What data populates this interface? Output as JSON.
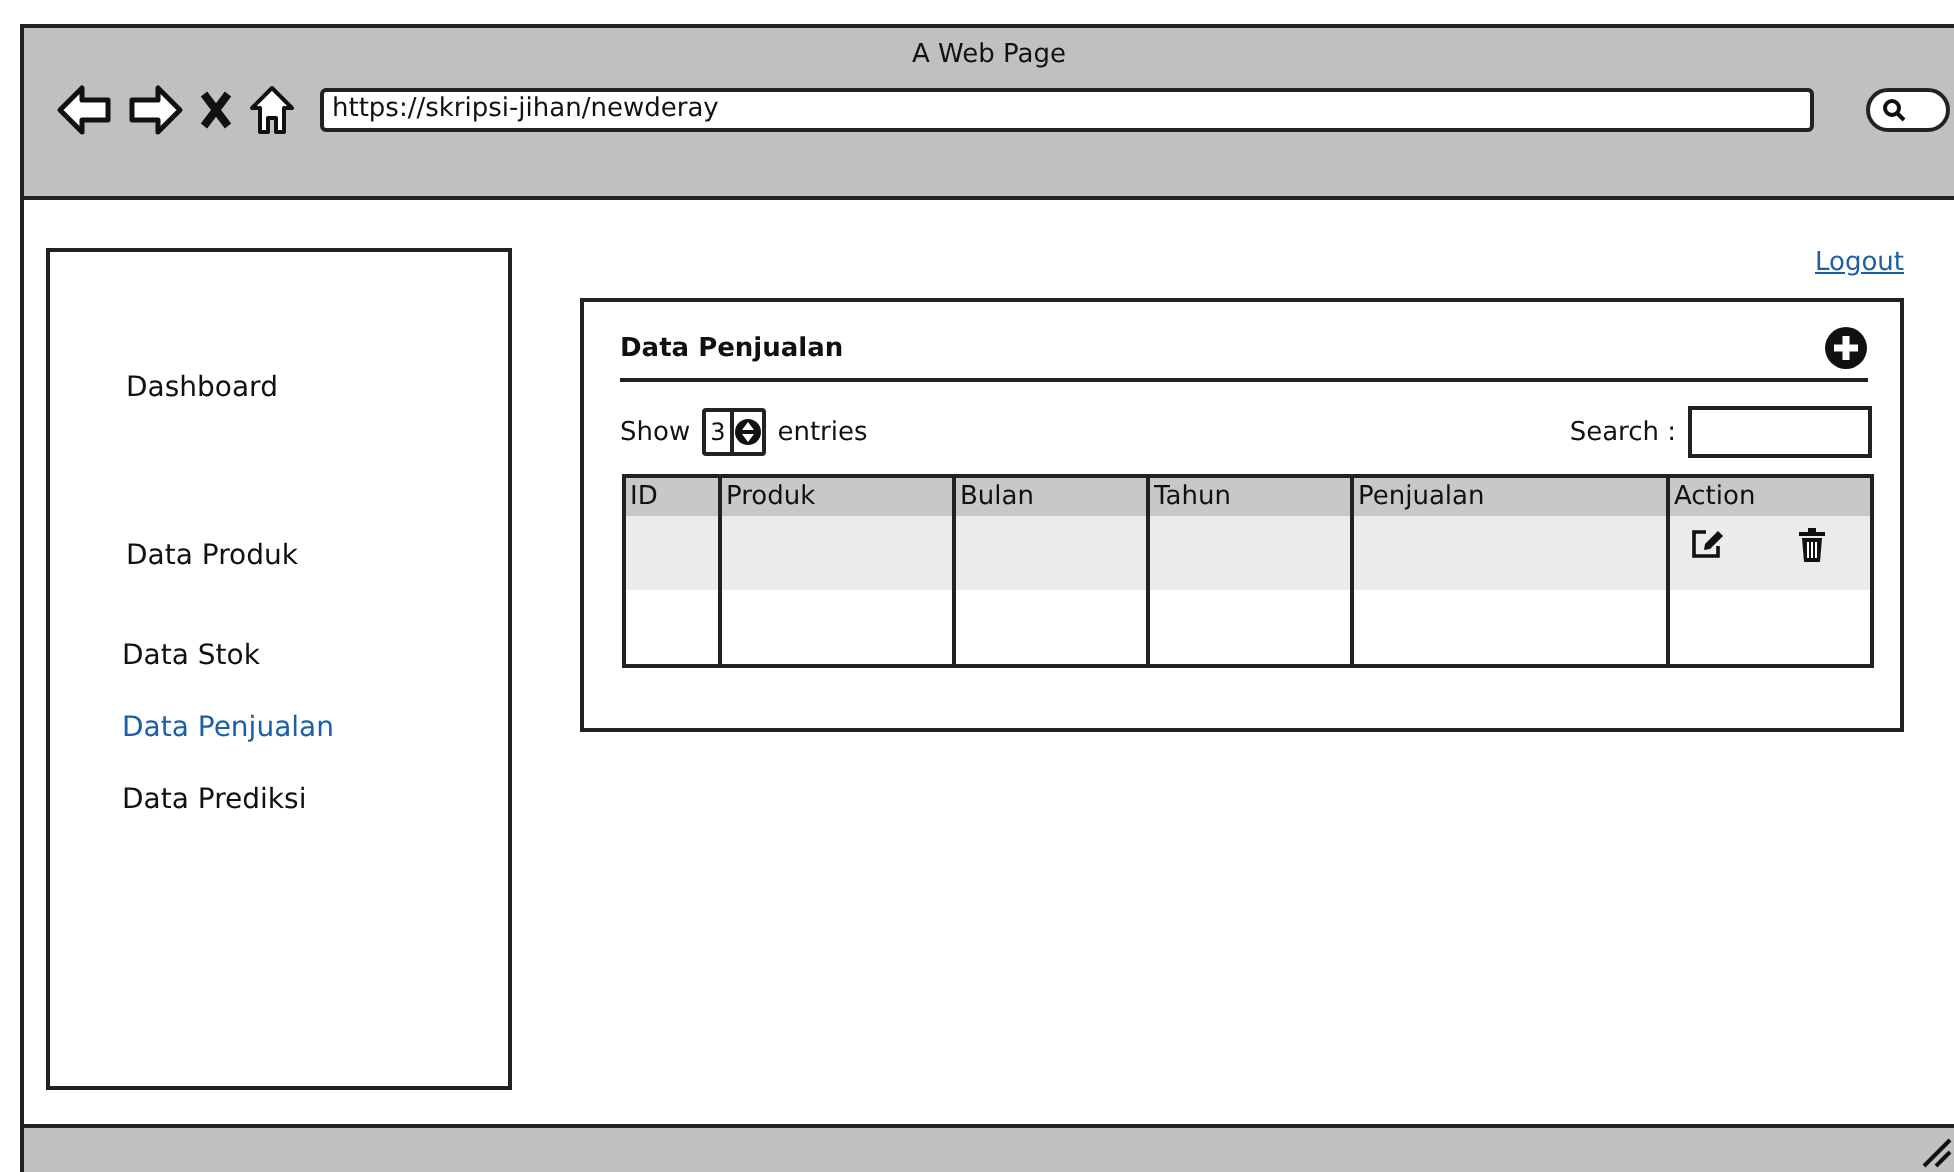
{
  "window": {
    "title": "A Web Page",
    "url": "https://skripsi-jihan/newderay"
  },
  "sidebar": {
    "items": [
      {
        "label": "Dashboard",
        "kind": "main",
        "selected": false
      },
      {
        "label": "Data Produk",
        "kind": "main",
        "selected": false
      },
      {
        "label": "Data Stok",
        "kind": "sub",
        "selected": false
      },
      {
        "label": "Data Penjualan",
        "kind": "sub",
        "selected": true
      },
      {
        "label": "Data Prediksi",
        "kind": "sub",
        "selected": false
      }
    ]
  },
  "logout": "Logout",
  "panel": {
    "title": "Data Penjualan",
    "show_label": "Show",
    "entries_value": "3",
    "entries_label": "entries",
    "search_label": "Search :",
    "table": {
      "columns": [
        "ID",
        "Produk",
        "Bulan",
        "Tahun",
        "Penjualan",
        "Action"
      ],
      "rows": [
        {
          "shaded": true,
          "actions": true
        },
        {
          "shaded": false,
          "actions": false
        }
      ]
    }
  }
}
